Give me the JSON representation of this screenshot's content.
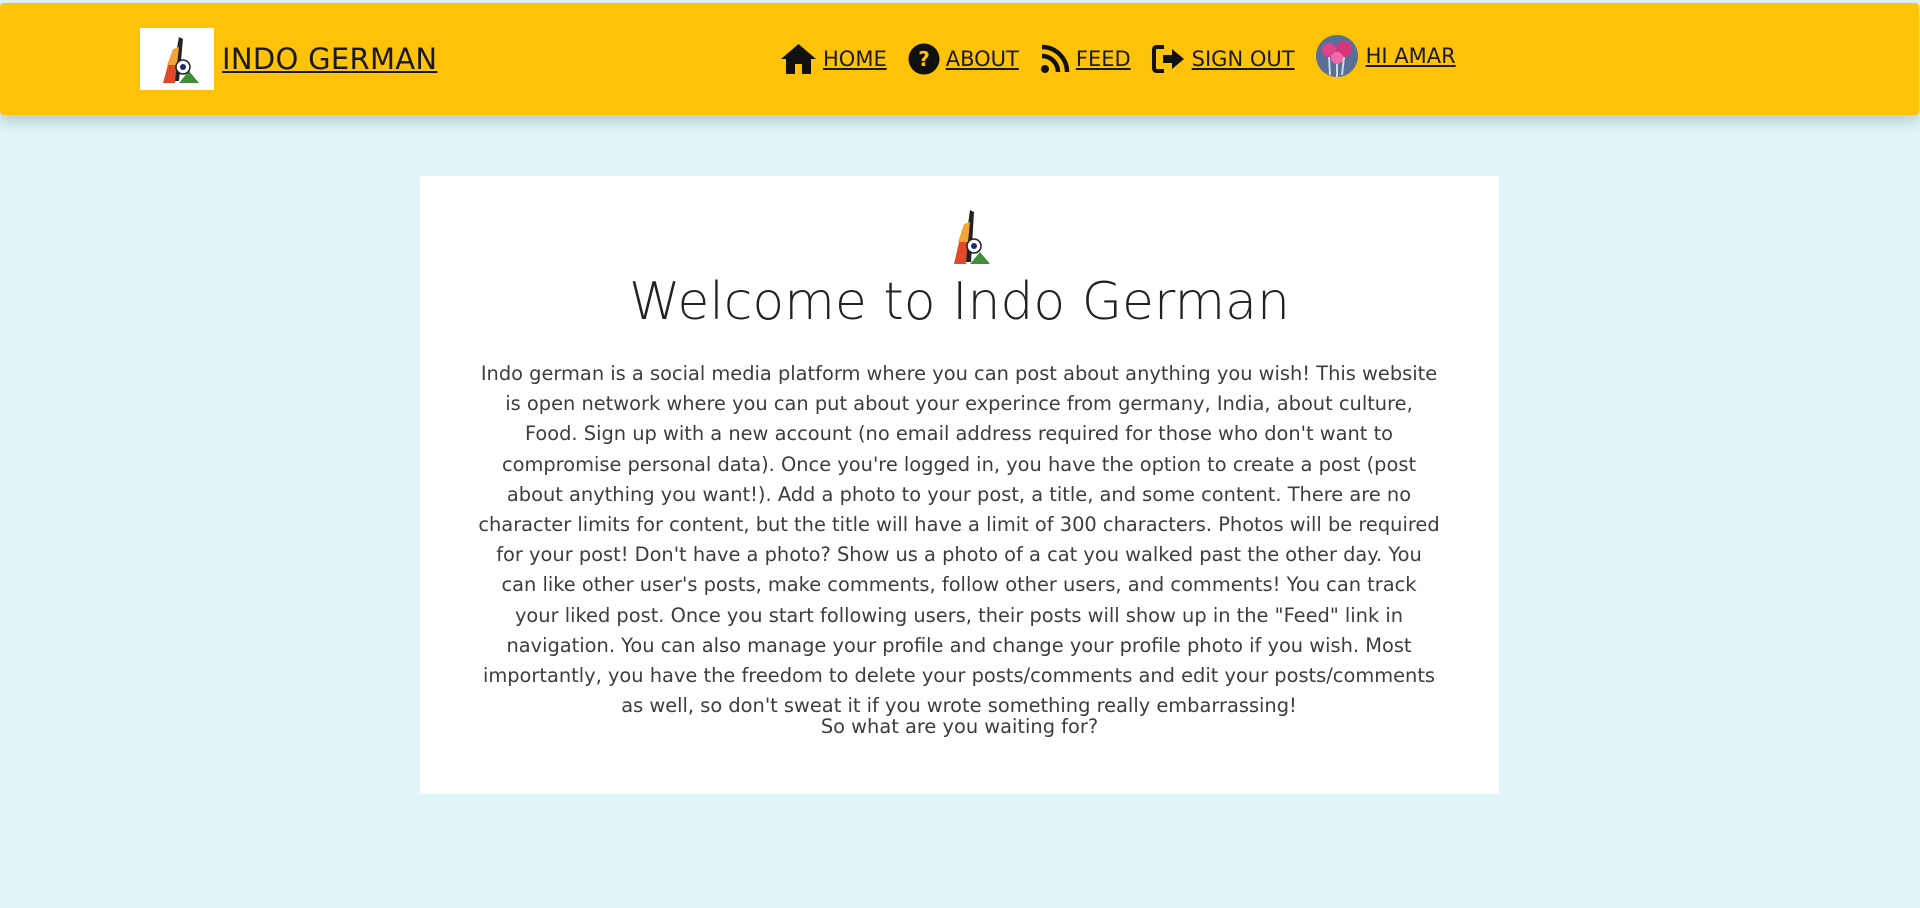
{
  "brand": {
    "name": " INDO GERMAN"
  },
  "nav": {
    "items": [
      {
        "label": "HOME",
        "icon": "home-icon"
      },
      {
        "label": "ABOUT",
        "icon": "question-circle-icon"
      },
      {
        "label": "FEED",
        "icon": "rss-icon"
      },
      {
        "label": "SIGN OUT",
        "icon": "sign-out-icon"
      }
    ],
    "profile_label": " HI AMAR"
  },
  "main": {
    "title": "Welcome to Indo German",
    "description": "Indo german is a social media platform where you can post about anything you wish! This website is open network where you can put about your experince from germany, India, about culture, Food. Sign up with a new account (no email address required for those who don't want to compromise personal data). Once you're logged in, you have the option to create a post (post about anything you want!). Add a photo to your post, a title, and some content. There are no character limits for content, but the title will have a limit of 300 characters. Photos will be required for your post! Don't have a photo? Show us a photo of a cat you walked past the other day. You can like other user's posts, make comments, follow other users, and comments! You can track your liked post. Once you start following users, their posts will show up in the \"Feed\" link in navigation. You can also manage your profile and change your profile photo if you wish. Most importantly, you have the freedom to delete your posts/comments and edit your posts/comments as well, so don't sweat it if you wrote something really embarrassing!",
    "cta": "So what are you waiting for?"
  },
  "colors": {
    "navbar": "#fec208",
    "background": "#dff5f7",
    "card": "#ffffff"
  }
}
